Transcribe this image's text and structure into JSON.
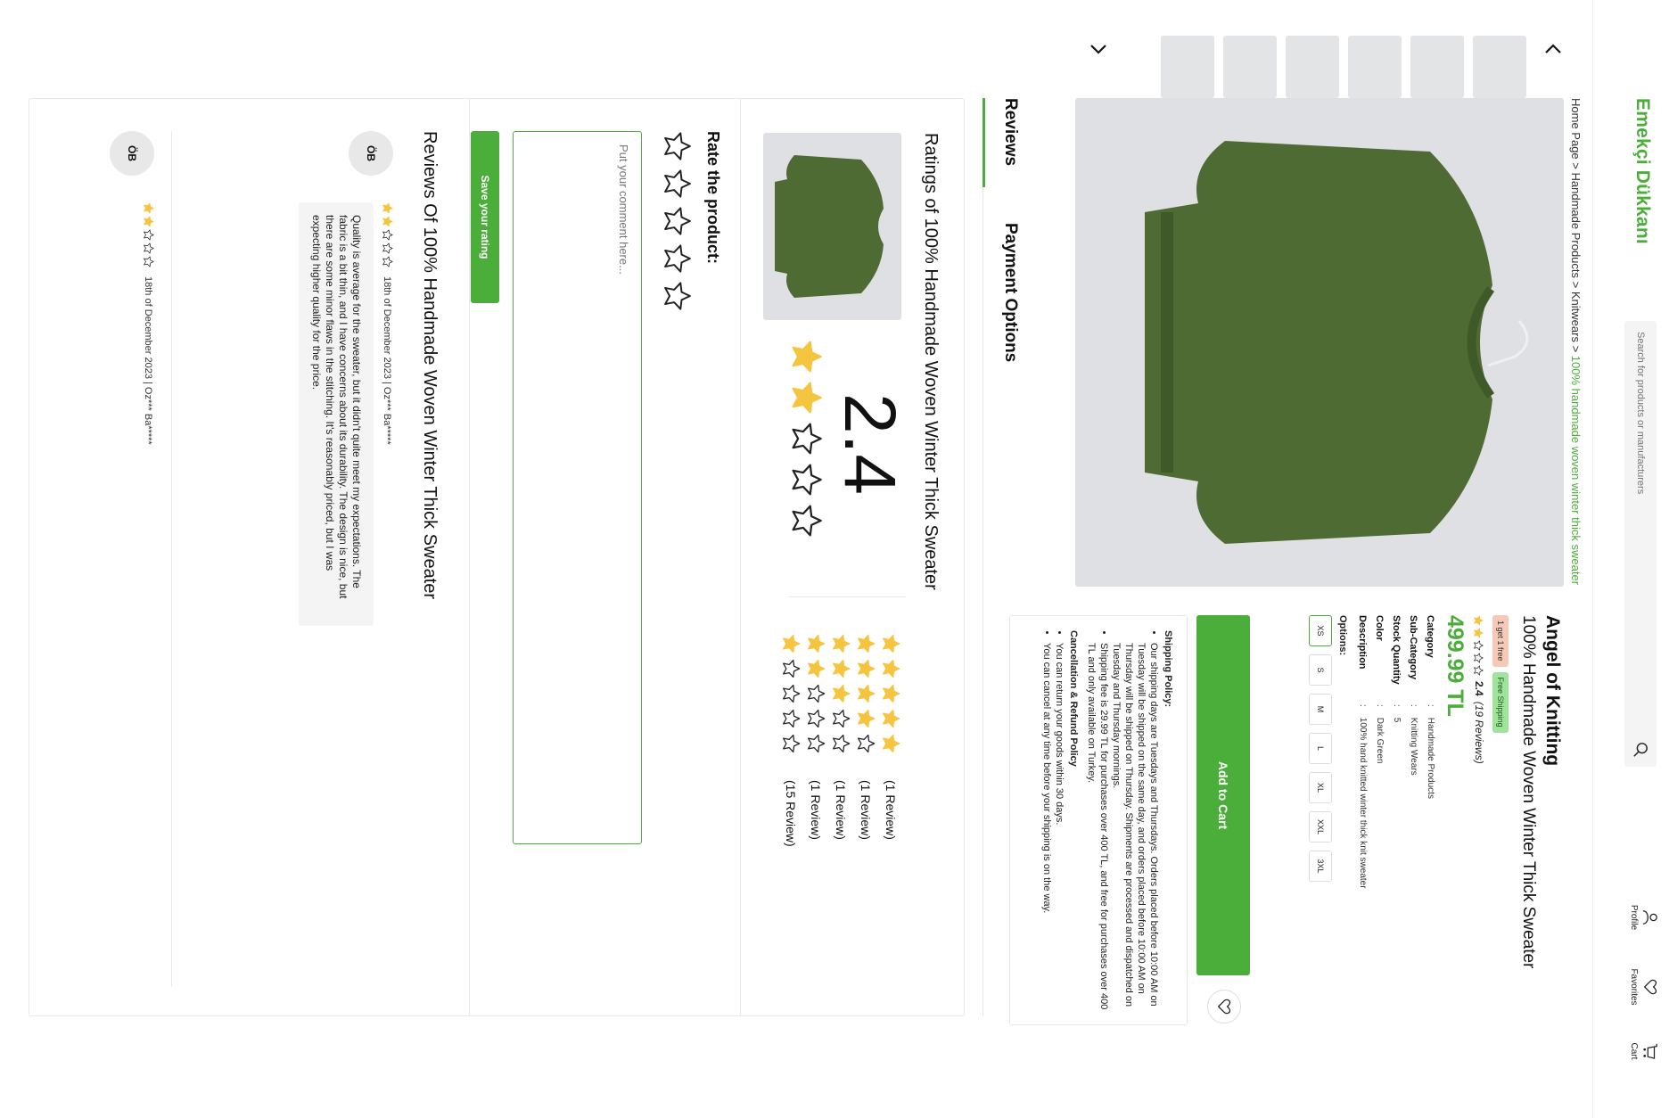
{
  "header": {
    "logo": "Emekçi Dükkanı",
    "search_placeholder": "Search for products or manufacturers",
    "profile_label": "Profile",
    "favorites_label": "Favorites",
    "cart_label": "Cart"
  },
  "breadcrumb": {
    "items": [
      "Home Page",
      "Handmade Products",
      "Knitwears"
    ],
    "separator": ">",
    "current": "100% handmade woven winter thick sweater"
  },
  "product": {
    "shop_name": "Angel of Knitting",
    "title": "100% Handmade Woven Winter Thick Sweater",
    "badge_gift": "1 get 1 free",
    "badge_shipping": "Free Shipping",
    "rating_value": 2.4,
    "rating_text": "2.4",
    "review_count": "(19 Reviews)",
    "price": "499.99 TL",
    "specs": [
      {
        "key": "Category",
        "value": "Handmade Products"
      },
      {
        "key": "Sub-Category",
        "value": "Knitting Wears"
      },
      {
        "key": "Stock Quantity",
        "value": "5"
      },
      {
        "key": "Color",
        "value": "Dark Green"
      },
      {
        "key": "Description",
        "value": "100% hand knitted winter thick knit sweater"
      }
    ],
    "options_label": "Options:",
    "options": [
      "XS",
      "S",
      "M",
      "L",
      "XL",
      "XXL",
      "3XL"
    ],
    "selected_option": "XS",
    "add_to_cart": "Add to Cart"
  },
  "policy": {
    "shipping_title": "Shipping Policy:",
    "shipping_items": [
      "Our shipping days are Tuesdays and Thursdays. Orders placed before 10:00 AM on Tuesday will be shipped on the same day, and orders placed before 10:00 AM on Thursday will be shipped on Thursday. Shipments are processed and dispatched on Tuesday and Thursday mornings.",
      "Shipping fee is 29.99 TL for purchases over 400 TL, and free for purchases over 400 TL and only available on Turkey."
    ],
    "cancel_title": "Cancellation & Refund Policy",
    "cancel_items": [
      "You can return your goods within 30 days.",
      "You can cancel at any time before your shipping is on the way."
    ]
  },
  "tabs": [
    "Reviews",
    "Payment Options"
  ],
  "ratings": {
    "title": "Ratings of 100% Handmade Woven Winter Thick Sweater",
    "average": "2.4",
    "average_stars": 2,
    "distribution": [
      {
        "stars": 5,
        "label": "(1 Review)"
      },
      {
        "stars": 4,
        "label": "(1 Review)"
      },
      {
        "stars": 3,
        "label": "(1 Review)"
      },
      {
        "stars": 2,
        "label": "(1 Review)"
      },
      {
        "stars": 1,
        "label": "(15 Review)"
      }
    ]
  },
  "rate": {
    "label": "Rate the product:",
    "comment_placeholder": "Put your comment here...",
    "save_button": "Save your rating"
  },
  "reviews": {
    "title": "Reviews Of 100% Handmade Woven Winter Thick Sweater",
    "items": [
      {
        "avatar": "ÖB",
        "stars": 2,
        "meta": "18th of December 2023 | Oz*** Ba*****",
        "text": "Quality is average for the sweater, but it didn't quite meet my expectations. The fabric is a bit thin, and I have concerns about its durability. The design is nice, but there are some minor flaws in the stitching. It's reasonably priced, but I was expecting higher quality for the price."
      },
      {
        "avatar": "ÖB",
        "stars": 2,
        "meta": "18th of December 2023 | Oz*** Ba*****",
        "text": ""
      }
    ]
  },
  "colors": {
    "accent": "#4cae3a",
    "star": "#f5c542"
  }
}
